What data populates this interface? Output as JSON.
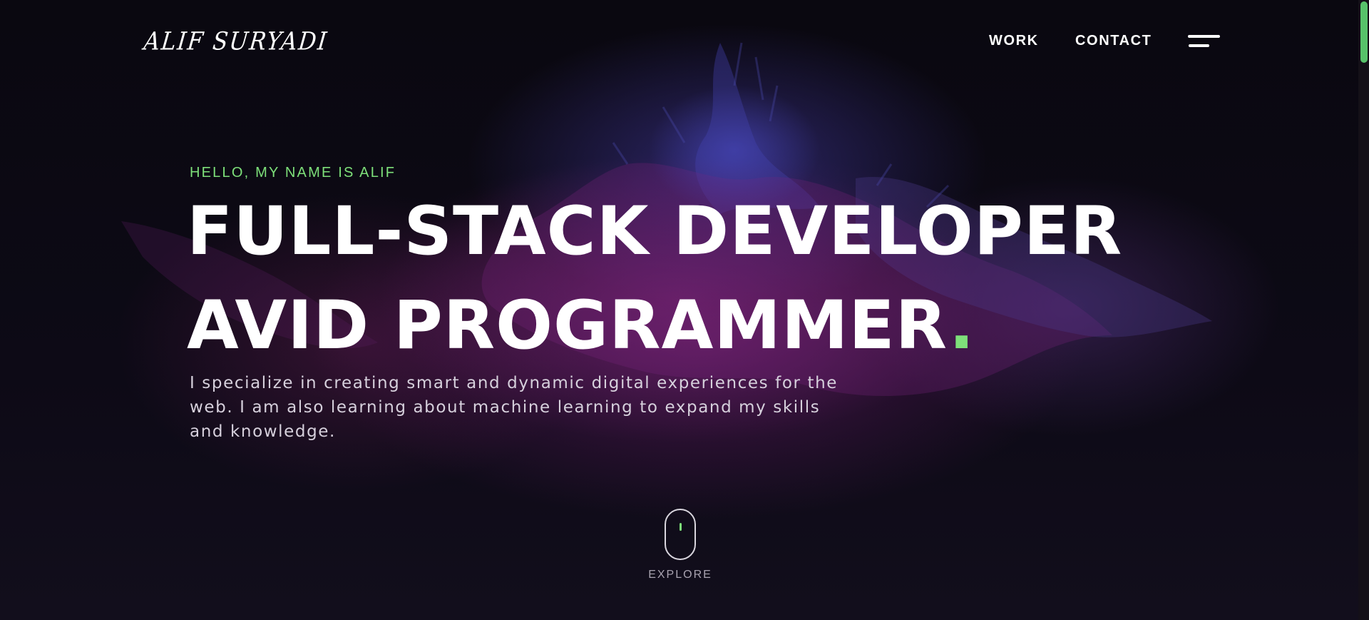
{
  "header": {
    "logo_text": "ALIF SURYADI",
    "nav": {
      "work_label": "WORK",
      "contact_label": "CONTACT"
    },
    "menu_icon": "hamburger-menu-icon"
  },
  "hero": {
    "kicker": "HELLO, MY NAME IS ALIF",
    "headline_line1": "FULL-STACK DEVELOPER",
    "headline_line2": "AVID PROGRAMMER",
    "headline_dot": ".",
    "description": "I specialize in creating smart and dynamic digital experiences for the web. I am also learning about machine learning to expand my skills and knowledge."
  },
  "scroll_indicator": {
    "icon": "mouse-scroll-icon",
    "label": "EXPLORE"
  },
  "colors": {
    "accent": "#7ee07a",
    "background": "#0b0912",
    "text": "#ffffff",
    "scrollbar_thumb": "#57c26a"
  }
}
